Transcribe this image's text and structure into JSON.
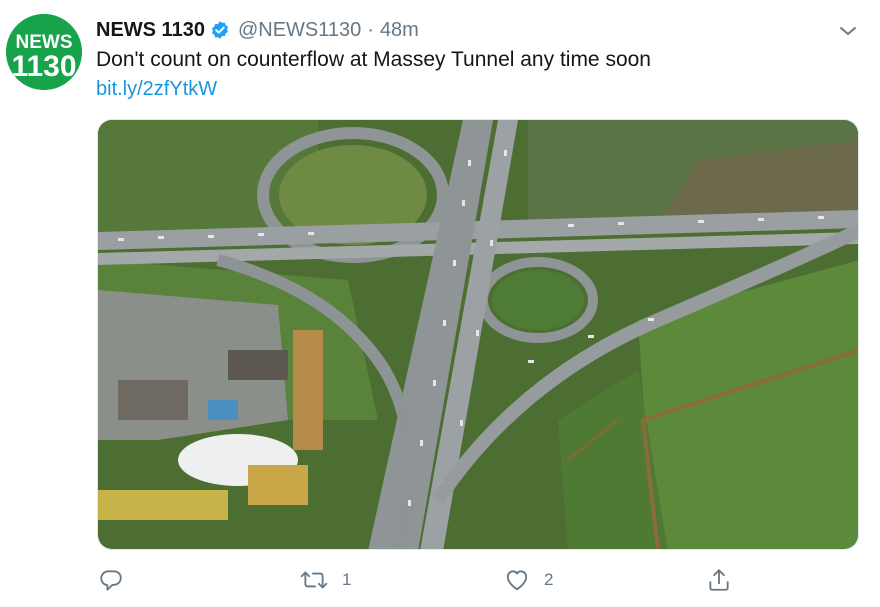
{
  "tweet": {
    "avatar_text_top": "NEWS",
    "avatar_text_bottom": "1130",
    "display_name": "NEWS 1130",
    "verified_icon": "verified-badge-icon",
    "handle": "@NEWS1130",
    "separator": "·",
    "time": "48m",
    "text": "Don't count on counterflow at Massey Tunnel any time soon",
    "link": "bit.ly/2zfYtkW",
    "menu_icon": "chevron-down-icon"
  },
  "actions": {
    "reply": {
      "icon": "reply-icon",
      "count": ""
    },
    "retweet": {
      "icon": "retweet-icon",
      "count": "1"
    },
    "like": {
      "icon": "heart-icon",
      "count": "2"
    },
    "share": {
      "icon": "share-icon",
      "count": ""
    }
  },
  "colors": {
    "avatar_green": "#17a34a",
    "verified_blue": "#1da1f2",
    "link_blue": "#1b95e0",
    "muted_gray": "#657786"
  }
}
